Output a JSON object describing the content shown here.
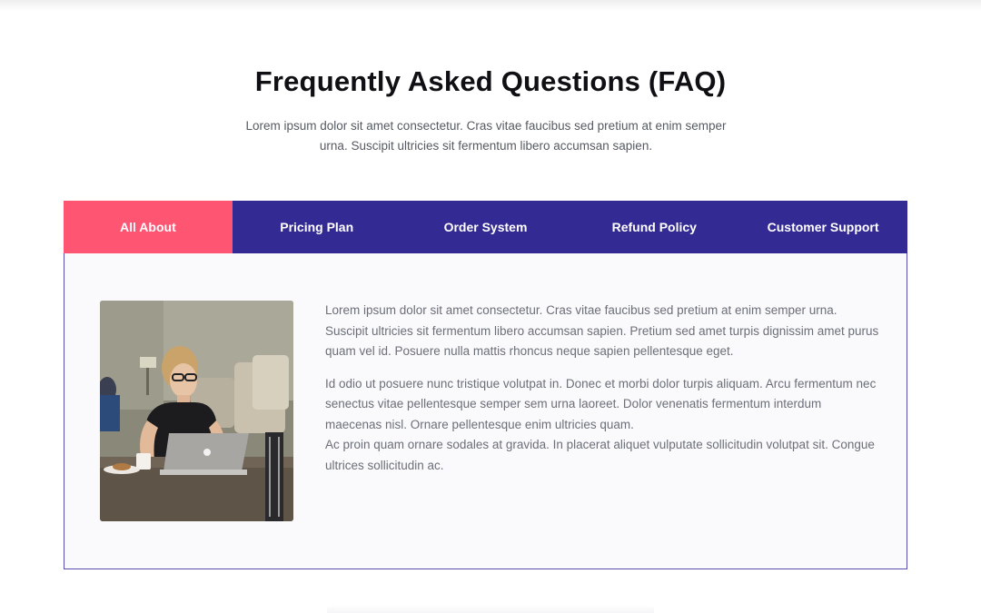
{
  "header": {
    "title": "Frequently Asked Questions (FAQ)",
    "subtitle": "Lorem ipsum dolor sit amet consectetur. Cras vitae faucibus sed pretium at enim semper urna. Suscipit ultricies sit fermentum libero accumsan sapien."
  },
  "tabs": [
    {
      "label": "All About",
      "active": true
    },
    {
      "label": "Pricing Plan",
      "active": false
    },
    {
      "label": "Order System",
      "active": false
    },
    {
      "label": "Refund Policy",
      "active": false
    },
    {
      "label": "Customer Support",
      "active": false
    }
  ],
  "content": {
    "paragraph_1": "Lorem ipsum dolor sit amet consectetur. Cras vitae faucibus sed pretium at enim semper urna. Suscipit ultricies sit fermentum libero accumsan sapien. Pretium sed amet turpis dignissim amet purus quam vel id. Posuere nulla mattis rhoncus neque sapien pellentesque eget.",
    "paragraph_2": "Id odio ut posuere nunc tristique volutpat in. Donec et morbi dolor turpis aliquam. Arcu fermentum nec senectus vitae pellentesque semper sem urna laoreet. Dolor venenatis fermentum interdum maecenas nisl. Ornare pellentesque enim ultricies quam.",
    "paragraph_3": "Ac proin quam ornare sodales at gravida. In placerat aliquet vulputate sollicitudin volutpat sit. Congue ultrices sollicitudin ac."
  },
  "colors": {
    "tab_bar": "#332a93",
    "tab_active": "#fe5573",
    "panel_border": "#554db0",
    "panel_bg": "#fafafd"
  }
}
